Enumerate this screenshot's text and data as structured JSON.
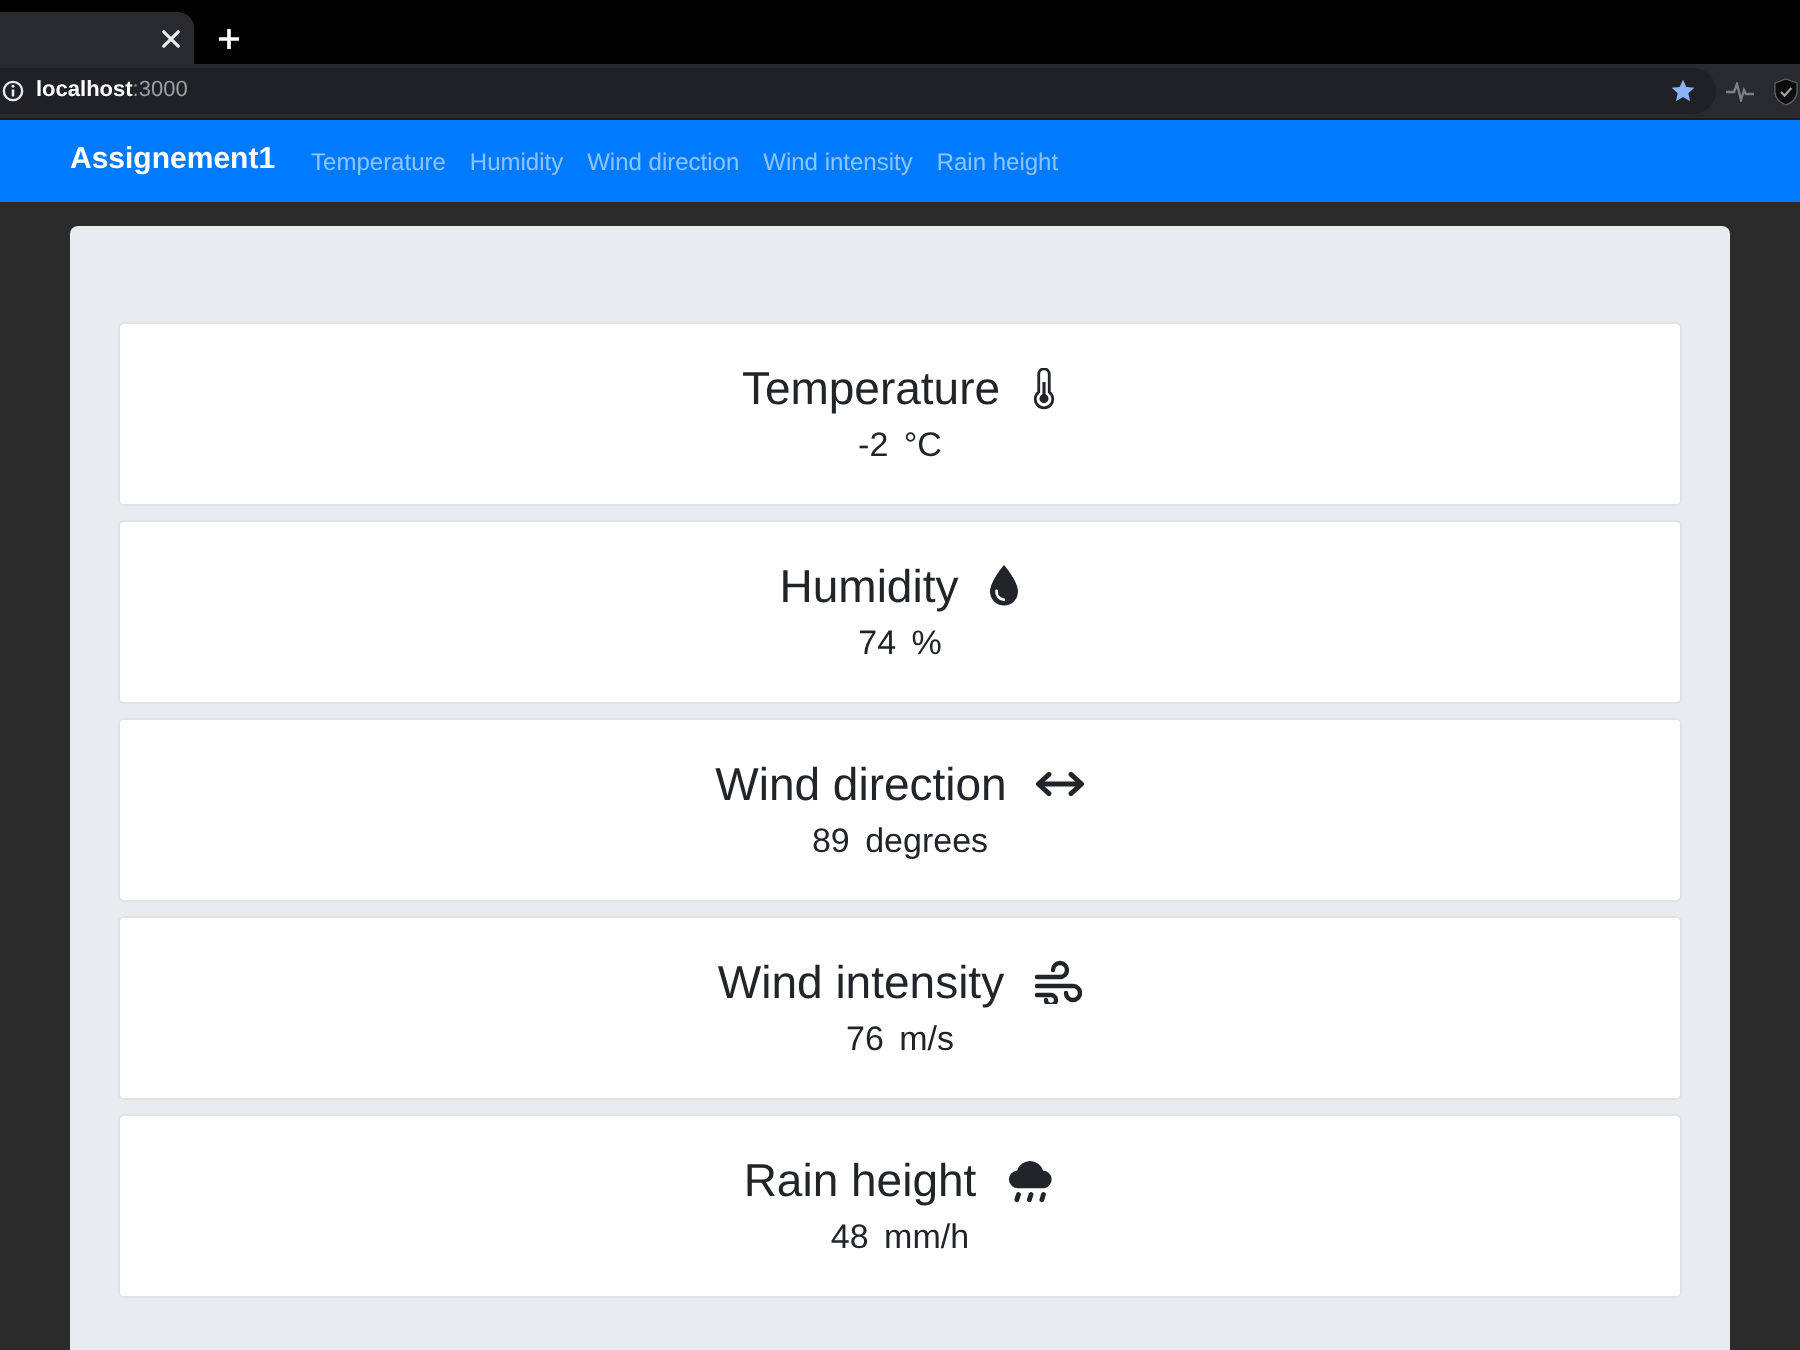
{
  "address_bar": {
    "host": "localhost",
    "port": ":3000"
  },
  "navbar": {
    "brand": "Assignement1",
    "links": [
      "Temperature",
      "Humidity",
      "Wind direction",
      "Wind intensity",
      "Rain height"
    ]
  },
  "cards": [
    {
      "title": "Temperature",
      "reading": "-2 °C"
    },
    {
      "title": "Humidity",
      "reading": "74 %"
    },
    {
      "title": "Wind direction",
      "reading": "89 degrees"
    },
    {
      "title": "Wind intensity",
      "reading": "76 m/s"
    },
    {
      "title": "Rain height",
      "reading": "48 mm/h"
    }
  ]
}
